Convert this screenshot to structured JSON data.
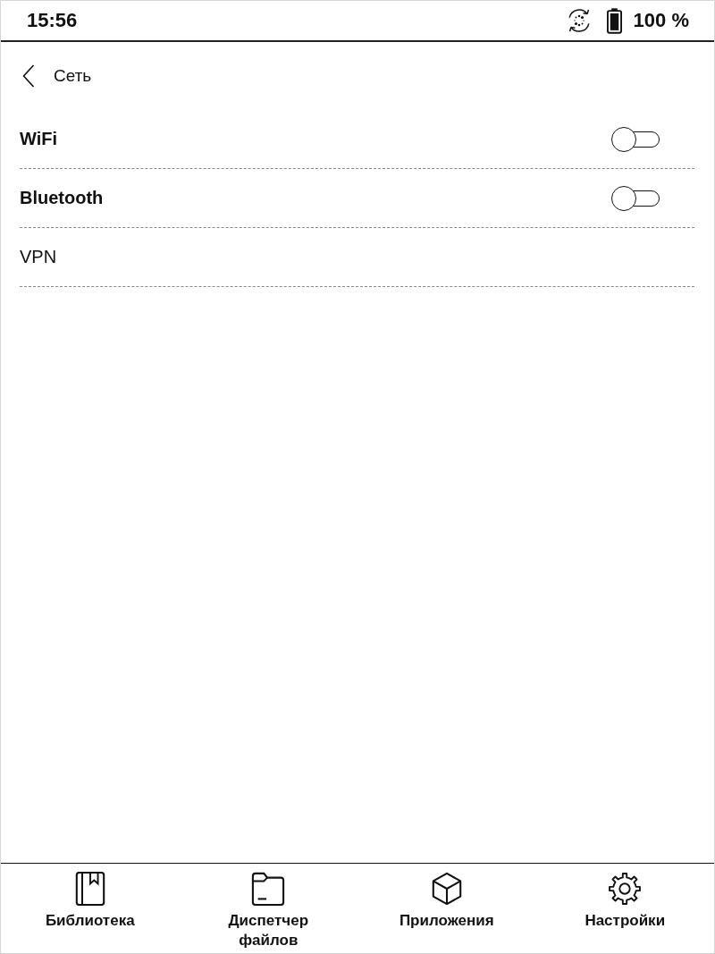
{
  "status_bar": {
    "time": "15:56",
    "battery_text": "100 %"
  },
  "header": {
    "title": "Сеть"
  },
  "settings": [
    {
      "kind": "toggle",
      "label": "WiFi",
      "on": false
    },
    {
      "kind": "toggle",
      "label": "Bluetooth",
      "on": false
    },
    {
      "kind": "link",
      "label": "VPN"
    }
  ],
  "bottom_nav": [
    {
      "label": "Библиотека"
    },
    {
      "label": "Диспетчер файлов"
    },
    {
      "label": "Приложения"
    },
    {
      "label": "Настройки"
    }
  ]
}
